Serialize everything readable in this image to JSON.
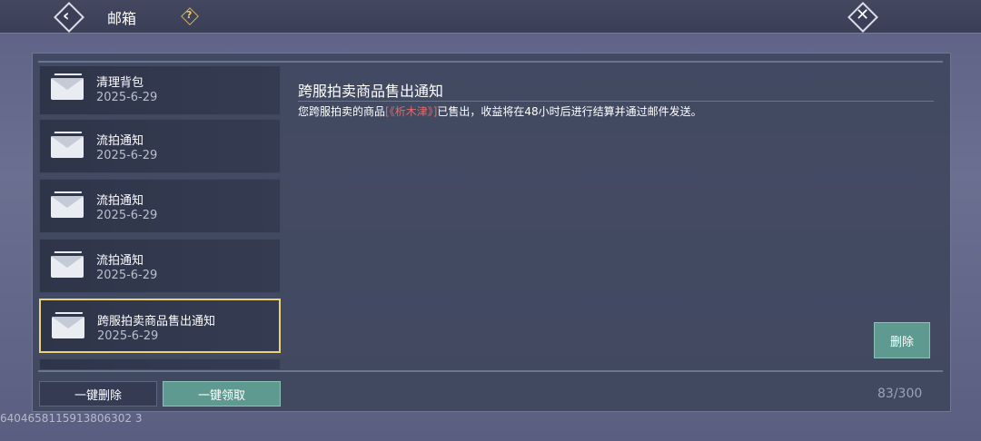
{
  "header": {
    "title": "邮箱",
    "back_icon": "chevron-left-icon",
    "help_icon": "question-icon",
    "close_icon": "close-icon"
  },
  "mail_list": [
    {
      "subject": "清理背包",
      "date": "2025-6-29"
    },
    {
      "subject": "流拍通知",
      "date": "2025-6-29"
    },
    {
      "subject": "流拍通知",
      "date": "2025-6-29"
    },
    {
      "subject": "流拍通知",
      "date": "2025-6-29"
    },
    {
      "subject": "跨服拍卖商品售出通知",
      "date": "2025-6-29",
      "selected": true
    }
  ],
  "detail": {
    "title": "跨服拍卖商品售出通知",
    "body_prefix": "您跨服拍卖的商品",
    "item_name": "[《析木津》]",
    "body_suffix": "已售出，收益将在48小时后进行结算并通过邮件发送。",
    "delete_label": "删除"
  },
  "footer": {
    "bulk_delete_label": "一键删除",
    "bulk_claim_label": "一键领取",
    "count": "83/300"
  },
  "uid": "6404658115913806302 3",
  "colors": {
    "accent_teal": "#5f9a91",
    "selected_border": "#e7d47a",
    "highlight_red": "#e06a6a"
  }
}
